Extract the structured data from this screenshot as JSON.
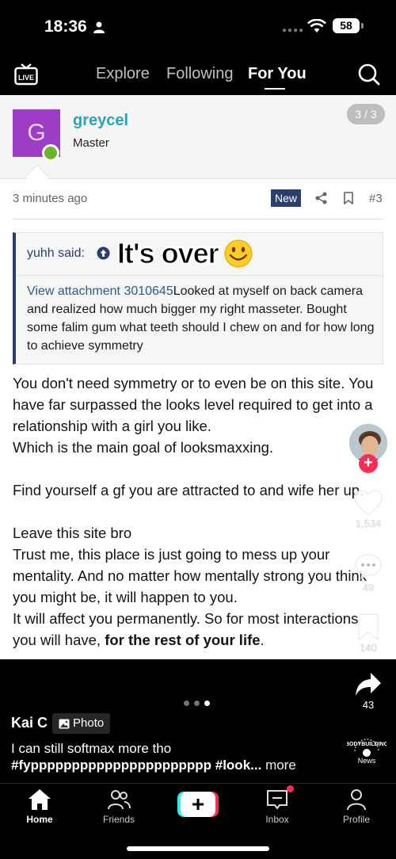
{
  "status_bar": {
    "time": "18:36",
    "battery": "58"
  },
  "top_nav": {
    "tabs": [
      "Explore",
      "Following",
      "For You"
    ],
    "active_tab": "For You"
  },
  "post_image": {
    "forum_user": {
      "avatar_letter": "G",
      "name": "greycel",
      "title": "Master"
    },
    "pager": "3 / 3",
    "timestamp": "3 minutes ago",
    "badge": "New",
    "post_number": "#3",
    "quote": {
      "author": "yuhh said:",
      "sticker": "It's over",
      "attachment_link": "View attachment 3010645",
      "text": "Looked at myself on back camera and realized how much bigger my right masseter. Bought some falim gum what teeth should I chew on and for how long to achieve symmetry"
    },
    "reply": {
      "p1": "You don't need symmetry or to even be on this site. You have far surpassed the looks level required to get into a relationship with a girl you like.",
      "p2": "Which is the main goal of looksmaxxing.",
      "p3": "Find yourself a gf you are attracted to and wife her up.",
      "p4": "Leave this site bro",
      "p5": "Trust me, this place is just going to mess up your mentality. And no matter how mentally strong you think you might be, it will happen to you.",
      "p6_normal": "It will affect you permanently. So for most interactions you will have, ",
      "p6_bold": "for the rest of your life",
      "p6_end": "."
    }
  },
  "right_rail": {
    "likes": "1,534",
    "comments": "49",
    "saves": "140",
    "shares": "43"
  },
  "caption": {
    "author": "Kai C",
    "photo_chip": "Photo",
    "line1": "I can still softmax more tho",
    "line2": "#fypppppppppppppppppppppp #look...",
    "more": "more",
    "music_label": "News"
  },
  "bottom_nav": {
    "items": [
      "Home",
      "Friends",
      "Inbox",
      "Profile"
    ]
  },
  "colors": {
    "accent": "#fe2c55",
    "forum_link": "#27a5b8",
    "forum_navy": "#2b3f6e"
  }
}
